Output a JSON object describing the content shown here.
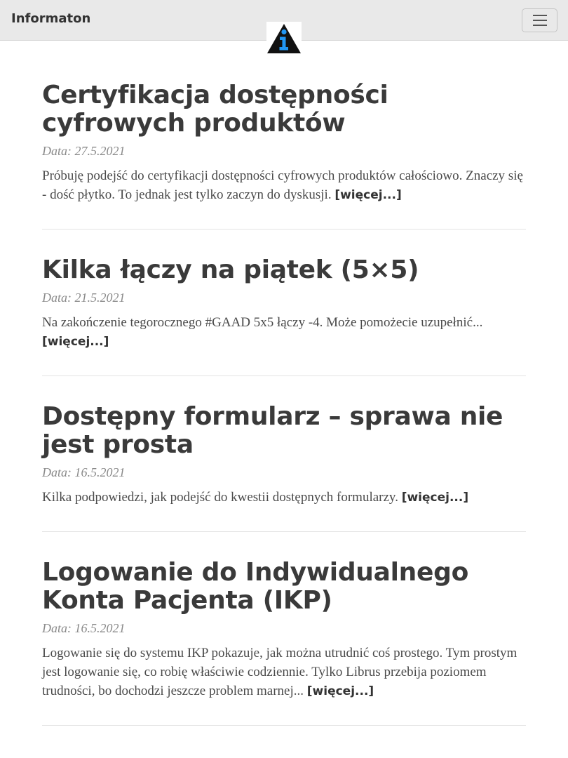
{
  "navbar": {
    "brand": "Informaton",
    "menu_icon": "hamburger-menu-icon",
    "logo_icon": "info-triangle-icon"
  },
  "colors": {
    "navbar_bg": "#e9e9e9",
    "logo_blue": "#2196f3",
    "text": "#3a3a3a"
  },
  "posts": [
    {
      "title": "Certyfikacja dostępności cyfrowych produktów",
      "date": "Data: 27.5.2021",
      "excerpt": "Próbuję podejść do certyfikacji dostępności cyfrowych produktów całościowo. Znaczy się - dość płytko. To jednak jest tylko zaczyn do dyskusji.",
      "more": "[więcej...]"
    },
    {
      "title": "Kilka łączy na piątek (5×5)",
      "date": "Data: 21.5.2021",
      "excerpt": "Na zakończenie tegorocznego #GAAD 5x5 łączy -4. Może pomożecie uzupełnić...",
      "more": "[więcej...]"
    },
    {
      "title": "Dostępny formularz – sprawa nie jest prosta",
      "date": "Data: 16.5.2021",
      "excerpt": "Kilka podpowiedzi, jak podejść do kwestii dostępnych formularzy.",
      "more": "[więcej...]"
    },
    {
      "title": "Logowanie do Indywidualnego Konta Pacjenta (IKP)",
      "date": "Data: 16.5.2021",
      "excerpt": "Logowanie się do systemu IKP pokazuje, jak można utrudnić coś prostego. Tym prostym jest logowanie się, co robię właściwie codziennie. Tylko Librus przebija poziomem trudności, bo dochodzi jeszcze problem marnej...",
      "more": "[więcej...]"
    }
  ]
}
